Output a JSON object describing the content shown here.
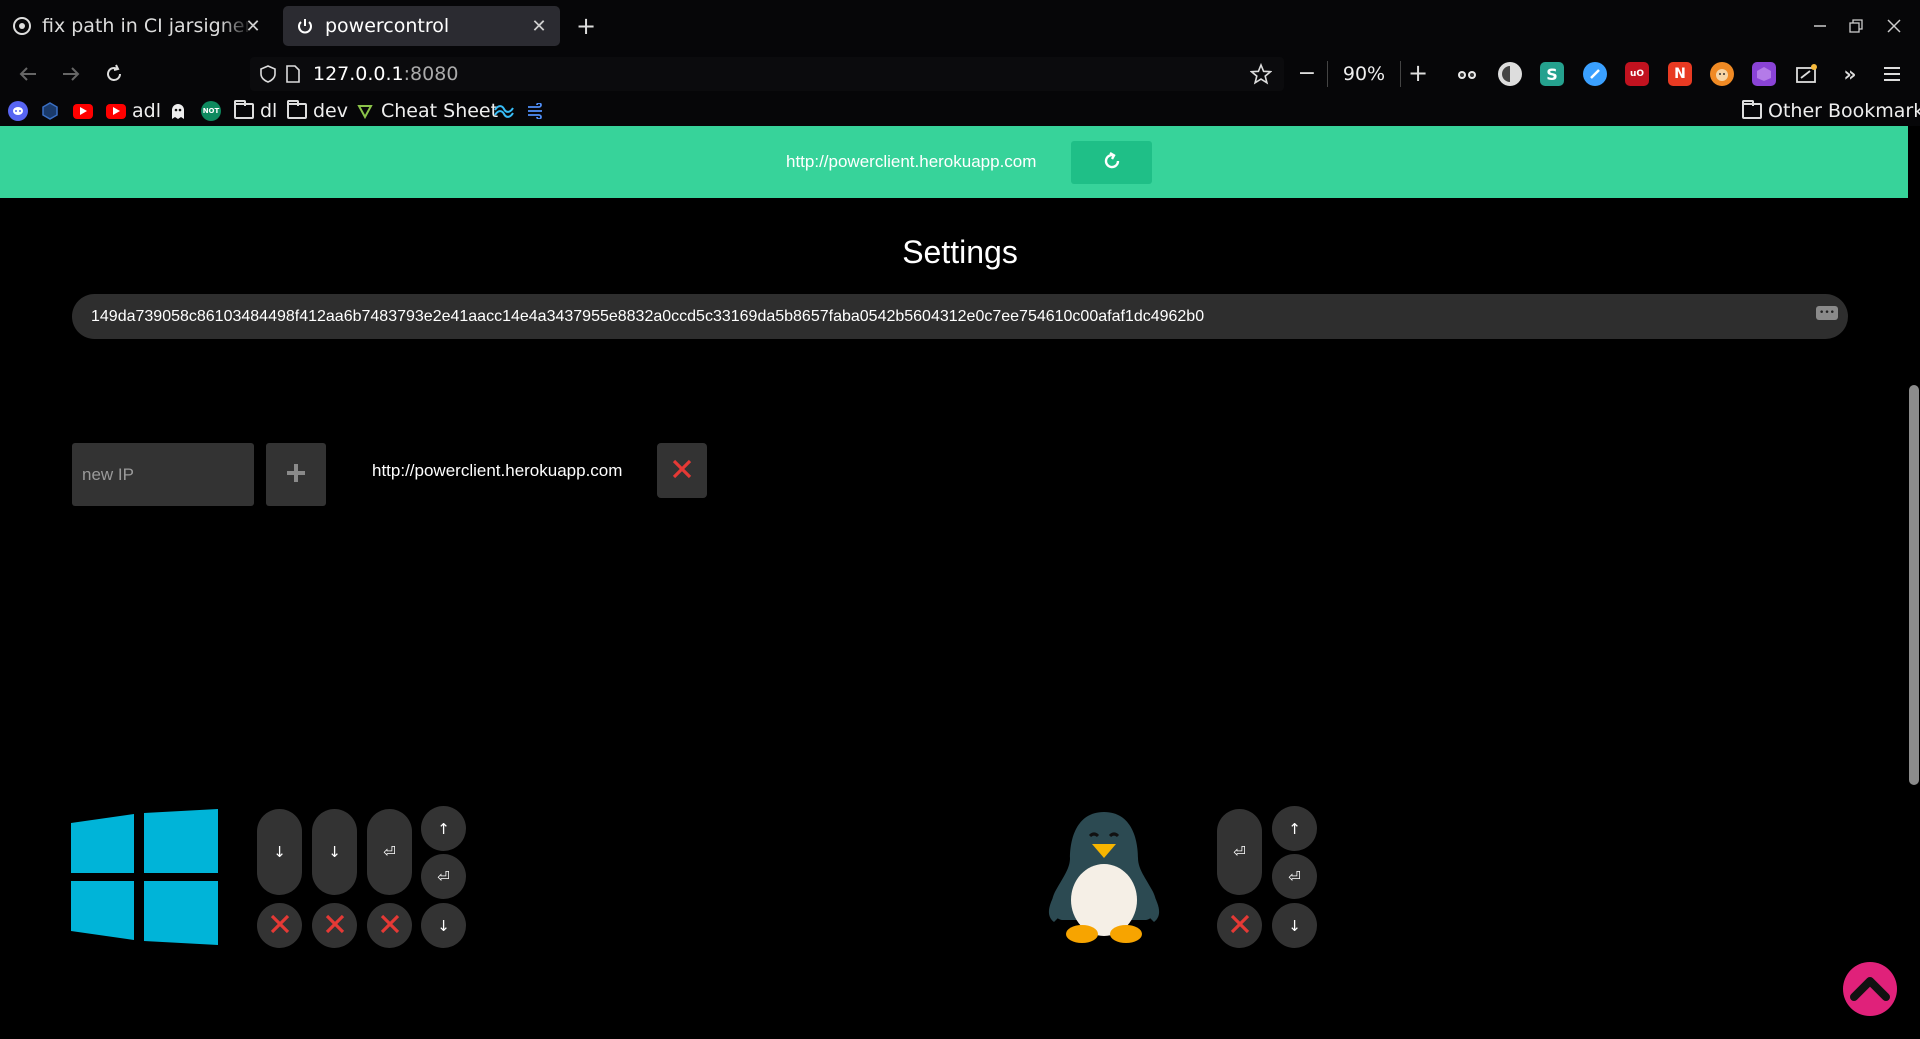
{
  "browser": {
    "tabs": [
      {
        "title": "fix path in CI jarsigner · m",
        "icon": "github-icon",
        "active": false
      },
      {
        "title": "powercontrol",
        "icon": "power-icon",
        "active": true
      }
    ],
    "url": {
      "host": "127.0.0.1",
      "port": ":8080"
    },
    "zoom": "90%",
    "extensions": [
      "glasses-extension-icon",
      "mask-extension-icon",
      "s-extension-icon",
      "pen-extension-icon",
      "ublock-extension-icon",
      "n-extension-icon",
      "fox-extension-icon",
      "cube-extension-icon",
      "tab-extension-icon"
    ],
    "bookmarks": {
      "items": [
        {
          "label": "",
          "icon": "discord-icon"
        },
        {
          "label": "",
          "icon": "shield-hex-icon"
        },
        {
          "label": "",
          "icon": "youtube-icon"
        },
        {
          "label": "adl",
          "icon": "youtube-icon"
        },
        {
          "label": "",
          "icon": "ghost-icon"
        },
        {
          "label": "",
          "icon": "not-badge-icon",
          "badge": "NOT"
        },
        {
          "label": "dl",
          "icon": "folder-icon"
        },
        {
          "label": "dev",
          "icon": "folder-icon"
        },
        {
          "label": "Cheat Sheet",
          "icon": "cheatsheet-icon"
        },
        {
          "label": "",
          "icon": "tailwind-icon"
        },
        {
          "label": "",
          "icon": "wind-icon"
        }
      ],
      "other": "Other Bookmarks"
    }
  },
  "page": {
    "current_server": "http://powerclient.herokuapp.com",
    "title": "Settings",
    "token": "149da739058c86103484498f412aa6b7483793e2e41aacc14e4a3437955e8832a0ccd5c33169da5b8657faba0542b5604312e0c7ee754610c00afaf1dc4962b0",
    "new_ip_placeholder": "new IP",
    "ip_list": [
      "http://powerclient.herokuapp.com"
    ],
    "windows_controls": {
      "os_icon": "windows-logo-icon",
      "tall_buttons": [
        "↓",
        "↓",
        "⏎"
      ],
      "side_buttons": [
        "↑",
        "⏎",
        "↓"
      ]
    },
    "linux_controls": {
      "os_icon": "linux-penguin-icon",
      "tall_buttons": [
        "⏎"
      ],
      "side_buttons": [
        "↑",
        "⏎",
        "↓"
      ]
    }
  },
  "colors": {
    "accent": "#37d39a",
    "accent_dark": "#1fbf87",
    "danger": "#e53935",
    "scroll_top": "#e0217a",
    "windows_blue": "#00b4d8"
  }
}
